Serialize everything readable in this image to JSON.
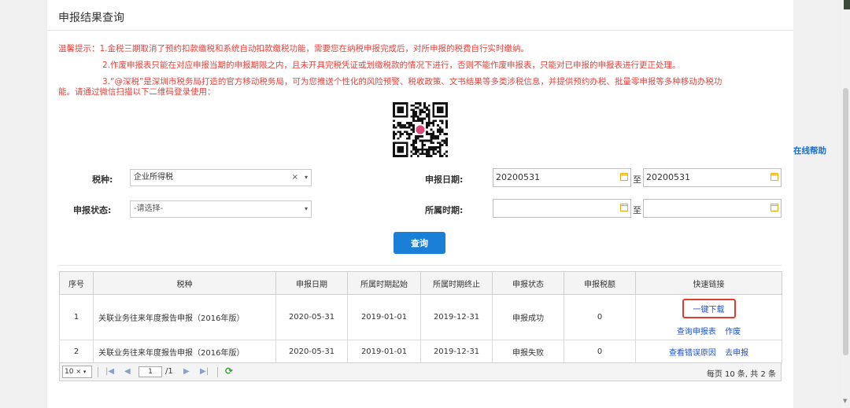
{
  "page": {
    "title": "申报结果查询"
  },
  "notice": {
    "line1": "温馨提示：1.金税三期取消了预约扣款缴税和系统自动扣款缴税功能，需要您在纳税申报完成后，对所申报的税费自行实时缴纳。",
    "line2": "2.作废申报表只能在对应申报当期的申报期限之内，且未开具完税凭证或划缴税款的情况下进行，否则不能作废申报表，只能对已申报的申报表进行更正处理。",
    "line3a": "3.“@深税”是深圳市税务局打造的官方移动税务局，可为您推送个性化的风险预警、税收政策、文书结果等多类涉税信息，并提供预约办税、批量零申报等多种移动办税功",
    "line3b": "能。请通过微信扫描以下二维码登录使用："
  },
  "form": {
    "tax_type_label": "税种:",
    "tax_type_value": "企业所得税",
    "status_label": "申报状态:",
    "status_placeholder": "-请选择-",
    "declare_date_label": "申报日期:",
    "declare_date_from": "20200531",
    "declare_date_to": "20200531",
    "period_label": "所属时期:",
    "period_from": "",
    "period_to": "",
    "to_word": "至",
    "clear_glyph": "×",
    "dropdown_glyph": "▾",
    "query_button": "查询"
  },
  "table": {
    "headers": [
      "序号",
      "税种",
      "申报日期",
      "所属时期起始",
      "所属时期终止",
      "申报状态",
      "申报税额",
      "快速链接"
    ],
    "rows": [
      {
        "no": "1",
        "tax": "关联业务往来年度报告申报（2016年版）",
        "date": "2020-05-31",
        "start": "2019-01-01",
        "end": "2019-12-31",
        "status": "申报成功",
        "amount": "0",
        "links": [
          "一键下载",
          "查询申报表",
          "作废"
        ]
      },
      {
        "no": "2",
        "tax": "关联业务往来年度报告申报（2016年版）",
        "date": "2020-05-31",
        "start": "2019-01-01",
        "end": "2019-12-31",
        "status": "申报失败",
        "amount": "0",
        "links": [
          "查看错误原因",
          "去申报"
        ]
      }
    ]
  },
  "pager": {
    "page_size": "10",
    "current_page": "1",
    "total_pages": "/1",
    "summary": "每页 10 条, 共 2 条"
  },
  "side": {
    "help": "在线帮助"
  },
  "colors": {
    "notice": "#e8423c",
    "primary_button": "#1a7fd6",
    "link": "#1b4fd8",
    "highlight_box": "#e23b30",
    "calendar_icon": "#f0a80f"
  },
  "icons": {
    "calendar": "calendar-icon",
    "refresh": "refresh-icon",
    "first": "first-page-icon",
    "prev": "prev-page-icon",
    "next": "next-page-icon",
    "last": "last-page-icon"
  }
}
